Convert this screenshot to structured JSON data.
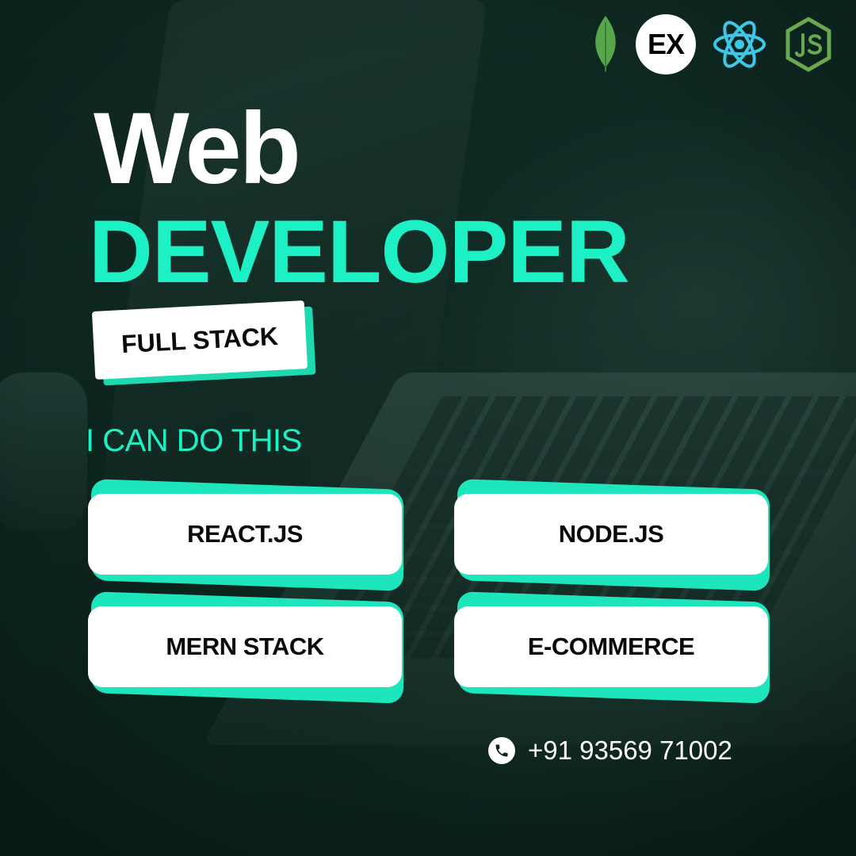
{
  "header": {
    "icons": [
      {
        "name": "mongodb-leaf-icon",
        "color": "#57a64a"
      },
      {
        "name": "express-icon",
        "label": "EX"
      },
      {
        "name": "react-atom-icon",
        "color": "#3fc7e8"
      },
      {
        "name": "nodejs-hexagon-icon",
        "color": "#6aa84f"
      }
    ]
  },
  "hero": {
    "title_line1": "Web",
    "title_line2": "DEVELOPER",
    "badge": "FULL STACK",
    "subtitle": "I CAN DO THIS"
  },
  "skills": [
    {
      "label": "REACT.JS"
    },
    {
      "label": "NODE.JS"
    },
    {
      "label": "MERN STACK"
    },
    {
      "label": "E-COMMERCE"
    }
  ],
  "contact": {
    "phone": "+91 93569 71002"
  },
  "colors": {
    "accent": "#1cf0c4",
    "background": "#0d2620",
    "card": "#ffffff"
  }
}
